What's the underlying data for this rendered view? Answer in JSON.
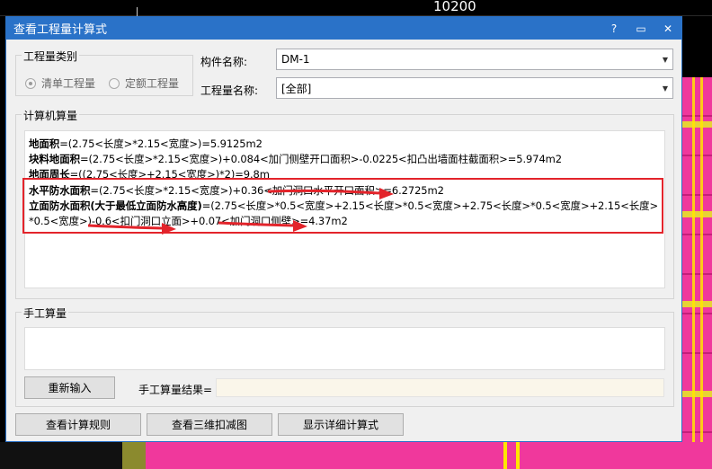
{
  "background": {
    "dimension_label": "10200"
  },
  "window": {
    "title": "查看工程量计算式",
    "help_icon": "?",
    "minimize_icon": "▭",
    "close_icon": "✕"
  },
  "quantity_type": {
    "group_label": "工程量类别",
    "option1": "清单工程量",
    "option2": "定额工程量",
    "selected": "清单工程量"
  },
  "fields": {
    "component_name_label": "构件名称:",
    "component_name_value": "DM-1",
    "quantity_name_label": "工程量名称:",
    "quantity_name_value": "[全部]"
  },
  "computer_calc": {
    "group_label": "计算机算量",
    "lines": [
      {
        "name": "地面积",
        "expr": "=(2.75<长度>*2.15<宽度>)=5.9125m2"
      },
      {
        "name": "块料地面积",
        "expr": "=(2.75<长度>*2.15<宽度>)+0.084<加门侧壁开口面积>-0.0225<扣凸出墙面柱截面积>=5.974m2"
      },
      {
        "name": "地面周长",
        "expr": "=((2.75<长度>+2.15<宽度>)*2)=9.8m"
      },
      {
        "name": "水平防水面积",
        "expr": "=(2.75<长度>*2.15<宽度>)+0.36<加门洞口水平开口面积>=6.2725m2"
      },
      {
        "name": "立面防水面积(大于最低立面防水高度)",
        "expr": "=(2.75<长度>*0.5<宽度>+2.15<长度>*0.5<宽度>+2.75<长度>*0.5<宽度>+2.15<长度>"
      },
      {
        "name": "",
        "expr": "*0.5<宽度>)-0.6<扣门洞口立面>+0.07<加门洞口侧壁>=4.37m2"
      }
    ]
  },
  "manual_calc": {
    "group_label": "手工算量",
    "reenter_button": "重新输入",
    "result_label": "手工算量结果="
  },
  "bottom_buttons": {
    "view_rules": "查看计算规则",
    "view_3d": "查看三维扣减图",
    "show_detail": "显示详细计算式"
  },
  "colors": {
    "titlebar": "#2a72c8",
    "highlight_box": "#e3242b",
    "cad_magenta": "#f0389c"
  }
}
